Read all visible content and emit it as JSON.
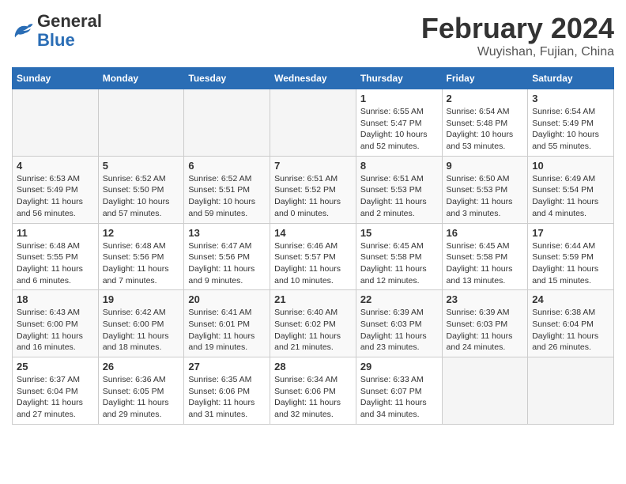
{
  "logo": {
    "general": "General",
    "blue": "Blue"
  },
  "title": {
    "month_year": "February 2024",
    "location": "Wuyishan, Fujian, China"
  },
  "headers": [
    "Sunday",
    "Monday",
    "Tuesday",
    "Wednesday",
    "Thursday",
    "Friday",
    "Saturday"
  ],
  "weeks": [
    [
      {
        "day": "",
        "empty": true
      },
      {
        "day": "",
        "empty": true
      },
      {
        "day": "",
        "empty": true
      },
      {
        "day": "",
        "empty": true
      },
      {
        "day": "1",
        "sunrise": "6:55 AM",
        "sunset": "5:47 PM",
        "daylight": "10 hours and 52 minutes."
      },
      {
        "day": "2",
        "sunrise": "6:54 AM",
        "sunset": "5:48 PM",
        "daylight": "10 hours and 53 minutes."
      },
      {
        "day": "3",
        "sunrise": "6:54 AM",
        "sunset": "5:49 PM",
        "daylight": "10 hours and 55 minutes."
      }
    ],
    [
      {
        "day": "4",
        "sunrise": "6:53 AM",
        "sunset": "5:49 PM",
        "daylight": "11 hours and 56 minutes."
      },
      {
        "day": "5",
        "sunrise": "6:52 AM",
        "sunset": "5:50 PM",
        "daylight": "10 hours and 57 minutes."
      },
      {
        "day": "6",
        "sunrise": "6:52 AM",
        "sunset": "5:51 PM",
        "daylight": "10 hours and 59 minutes."
      },
      {
        "day": "7",
        "sunrise": "6:51 AM",
        "sunset": "5:52 PM",
        "daylight": "11 hours and 0 minutes."
      },
      {
        "day": "8",
        "sunrise": "6:51 AM",
        "sunset": "5:53 PM",
        "daylight": "11 hours and 2 minutes."
      },
      {
        "day": "9",
        "sunrise": "6:50 AM",
        "sunset": "5:53 PM",
        "daylight": "11 hours and 3 minutes."
      },
      {
        "day": "10",
        "sunrise": "6:49 AM",
        "sunset": "5:54 PM",
        "daylight": "11 hours and 4 minutes."
      }
    ],
    [
      {
        "day": "11",
        "sunrise": "6:48 AM",
        "sunset": "5:55 PM",
        "daylight": "11 hours and 6 minutes."
      },
      {
        "day": "12",
        "sunrise": "6:48 AM",
        "sunset": "5:56 PM",
        "daylight": "11 hours and 7 minutes."
      },
      {
        "day": "13",
        "sunrise": "6:47 AM",
        "sunset": "5:56 PM",
        "daylight": "11 hours and 9 minutes."
      },
      {
        "day": "14",
        "sunrise": "6:46 AM",
        "sunset": "5:57 PM",
        "daylight": "11 hours and 10 minutes."
      },
      {
        "day": "15",
        "sunrise": "6:45 AM",
        "sunset": "5:58 PM",
        "daylight": "11 hours and 12 minutes."
      },
      {
        "day": "16",
        "sunrise": "6:45 AM",
        "sunset": "5:58 PM",
        "daylight": "11 hours and 13 minutes."
      },
      {
        "day": "17",
        "sunrise": "6:44 AM",
        "sunset": "5:59 PM",
        "daylight": "11 hours and 15 minutes."
      }
    ],
    [
      {
        "day": "18",
        "sunrise": "6:43 AM",
        "sunset": "6:00 PM",
        "daylight": "11 hours and 16 minutes."
      },
      {
        "day": "19",
        "sunrise": "6:42 AM",
        "sunset": "6:00 PM",
        "daylight": "11 hours and 18 minutes."
      },
      {
        "day": "20",
        "sunrise": "6:41 AM",
        "sunset": "6:01 PM",
        "daylight": "11 hours and 19 minutes."
      },
      {
        "day": "21",
        "sunrise": "6:40 AM",
        "sunset": "6:02 PM",
        "daylight": "11 hours and 21 minutes."
      },
      {
        "day": "22",
        "sunrise": "6:39 AM",
        "sunset": "6:03 PM",
        "daylight": "11 hours and 23 minutes."
      },
      {
        "day": "23",
        "sunrise": "6:39 AM",
        "sunset": "6:03 PM",
        "daylight": "11 hours and 24 minutes."
      },
      {
        "day": "24",
        "sunrise": "6:38 AM",
        "sunset": "6:04 PM",
        "daylight": "11 hours and 26 minutes."
      }
    ],
    [
      {
        "day": "25",
        "sunrise": "6:37 AM",
        "sunset": "6:04 PM",
        "daylight": "11 hours and 27 minutes."
      },
      {
        "day": "26",
        "sunrise": "6:36 AM",
        "sunset": "6:05 PM",
        "daylight": "11 hours and 29 minutes."
      },
      {
        "day": "27",
        "sunrise": "6:35 AM",
        "sunset": "6:06 PM",
        "daylight": "11 hours and 31 minutes."
      },
      {
        "day": "28",
        "sunrise": "6:34 AM",
        "sunset": "6:06 PM",
        "daylight": "11 hours and 32 minutes."
      },
      {
        "day": "29",
        "sunrise": "6:33 AM",
        "sunset": "6:07 PM",
        "daylight": "11 hours and 34 minutes."
      },
      {
        "day": "",
        "empty": true
      },
      {
        "day": "",
        "empty": true
      }
    ]
  ],
  "labels": {
    "sunrise": "Sunrise:",
    "sunset": "Sunset:",
    "daylight": "Daylight:"
  }
}
